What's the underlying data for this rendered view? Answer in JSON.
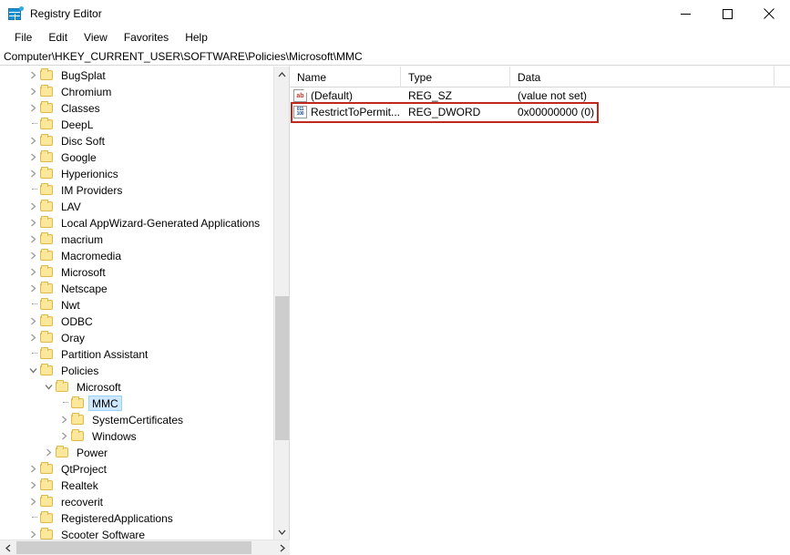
{
  "window": {
    "title": "Registry Editor",
    "icon": "registry-editor-icon",
    "controls": {
      "minimize": "minimize-icon",
      "maximize": "maximize-icon",
      "close": "close-icon"
    }
  },
  "menubar": {
    "items": [
      {
        "label": "File"
      },
      {
        "label": "Edit"
      },
      {
        "label": "View"
      },
      {
        "label": "Favorites"
      },
      {
        "label": "Help"
      }
    ]
  },
  "address": {
    "path": "Computer\\HKEY_CURRENT_USER\\SOFTWARE\\Policies\\Microsoft\\MMC"
  },
  "tree": {
    "items": [
      {
        "label": "BugSplat",
        "depth": 1,
        "expander": "collapsed",
        "selected": false
      },
      {
        "label": "Chromium",
        "depth": 1,
        "expander": "collapsed",
        "selected": false
      },
      {
        "label": "Classes",
        "depth": 1,
        "expander": "collapsed",
        "selected": false
      },
      {
        "label": "DeepL",
        "depth": 1,
        "expander": "none",
        "selected": false
      },
      {
        "label": "Disc Soft",
        "depth": 1,
        "expander": "collapsed",
        "selected": false
      },
      {
        "label": "Google",
        "depth": 1,
        "expander": "collapsed",
        "selected": false
      },
      {
        "label": "Hyperionics",
        "depth": 1,
        "expander": "collapsed",
        "selected": false
      },
      {
        "label": "IM Providers",
        "depth": 1,
        "expander": "none",
        "selected": false
      },
      {
        "label": "LAV",
        "depth": 1,
        "expander": "collapsed",
        "selected": false
      },
      {
        "label": "Local AppWizard-Generated Applications",
        "depth": 1,
        "expander": "collapsed",
        "selected": false
      },
      {
        "label": "macrium",
        "depth": 1,
        "expander": "collapsed",
        "selected": false
      },
      {
        "label": "Macromedia",
        "depth": 1,
        "expander": "collapsed",
        "selected": false
      },
      {
        "label": "Microsoft",
        "depth": 1,
        "expander": "collapsed",
        "selected": false
      },
      {
        "label": "Netscape",
        "depth": 1,
        "expander": "collapsed",
        "selected": false
      },
      {
        "label": "Nwt",
        "depth": 1,
        "expander": "none",
        "selected": false
      },
      {
        "label": "ODBC",
        "depth": 1,
        "expander": "collapsed",
        "selected": false
      },
      {
        "label": "Oray",
        "depth": 1,
        "expander": "collapsed",
        "selected": false
      },
      {
        "label": "Partition Assistant",
        "depth": 1,
        "expander": "none",
        "selected": false
      },
      {
        "label": "Policies",
        "depth": 1,
        "expander": "expanded",
        "selected": false
      },
      {
        "label": "Microsoft",
        "depth": 2,
        "expander": "expanded",
        "selected": false
      },
      {
        "label": "MMC",
        "depth": 3,
        "expander": "none",
        "selected": true
      },
      {
        "label": "SystemCertificates",
        "depth": 3,
        "expander": "collapsed",
        "selected": false
      },
      {
        "label": "Windows",
        "depth": 3,
        "expander": "collapsed",
        "selected": false
      },
      {
        "label": "Power",
        "depth": 2,
        "expander": "collapsed",
        "selected": false
      },
      {
        "label": "QtProject",
        "depth": 1,
        "expander": "collapsed",
        "selected": false
      },
      {
        "label": "Realtek",
        "depth": 1,
        "expander": "collapsed",
        "selected": false
      },
      {
        "label": "recoverit",
        "depth": 1,
        "expander": "collapsed",
        "selected": false
      },
      {
        "label": "RegisteredApplications",
        "depth": 1,
        "expander": "none",
        "selected": false
      },
      {
        "label": "Scooter Software",
        "depth": 1,
        "expander": "collapsed",
        "selected": false
      }
    ],
    "selected_key": "MMC"
  },
  "values": {
    "columns": [
      "Name",
      "Type",
      "Data"
    ],
    "rows": [
      {
        "icon": "string-value-icon",
        "name": "(Default)",
        "type": "REG_SZ",
        "data": "(value not set)",
        "highlighted": false
      },
      {
        "icon": "dword-value-icon",
        "name": "RestrictToPermit...",
        "type": "REG_DWORD",
        "data": "0x00000000 (0)",
        "highlighted": true
      }
    ]
  },
  "annotation": {
    "highlight_color": "#c0271d",
    "highlighted_row_index": 1
  },
  "colors": {
    "selection": "#cce8ff",
    "folder": "#fde79b",
    "scrollbar_thumb": "#cdcdcd"
  }
}
